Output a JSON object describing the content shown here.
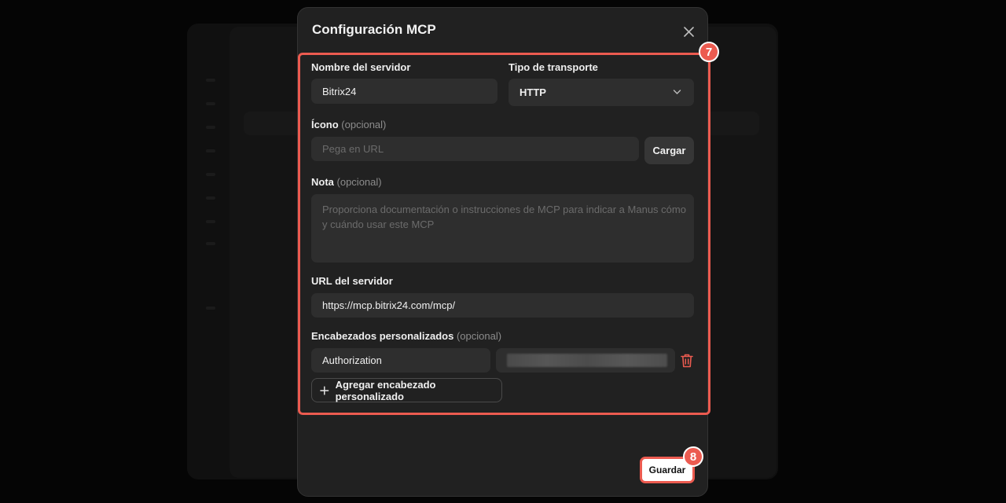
{
  "modal": {
    "title": "Configuración MCP",
    "close_icon": "close-icon"
  },
  "form": {
    "server_name": {
      "label": "Nombre del servidor",
      "value": "Bitrix24"
    },
    "transport": {
      "label": "Tipo de transporte",
      "value": "HTTP",
      "icon": "chevron-down-icon"
    },
    "icon_field": {
      "label": "Ícono",
      "optional": "(opcional)",
      "placeholder": "Pega en URL",
      "upload_label": "Cargar"
    },
    "note": {
      "label": "Nota",
      "optional": "(opcional)",
      "placeholder": "Proporciona documentación o instrucciones de MCP para indicar a Manus cómo y cuándo usar este MCP"
    },
    "server_url": {
      "label": "URL del servidor",
      "value": "https://mcp.bitrix24.com/mcp/"
    },
    "headers": {
      "label": "Encabezados personalizados",
      "optional": "(opcional)",
      "rows": [
        {
          "key": "Authorization",
          "value_hidden": true
        }
      ],
      "delete_icon": "trash-icon",
      "add_label": "Agregar encabezado personalizado",
      "add_icon": "plus-icon"
    }
  },
  "footer": {
    "save_label": "Guardar"
  },
  "annotations": {
    "step_7": "7",
    "step_8": "8",
    "highlight_color": "#ec5b50"
  }
}
